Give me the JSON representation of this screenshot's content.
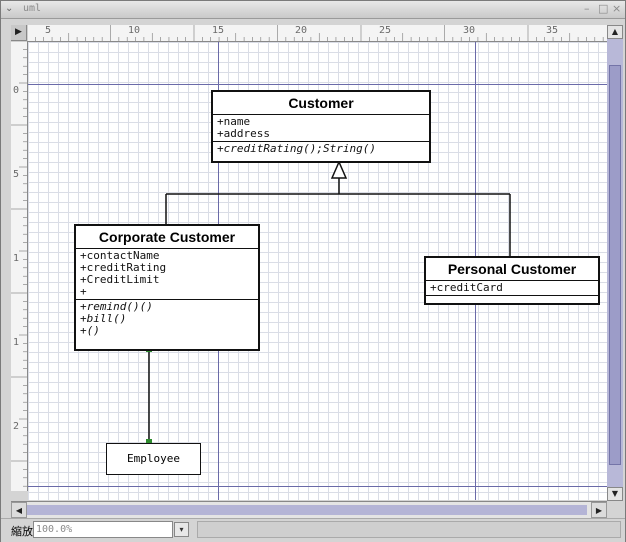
{
  "window": {
    "title": "uml",
    "minimize_glyph": "–",
    "maximize_glyph": "□",
    "close_glyph": "×"
  },
  "ruler": {
    "corner_glyph": "▶",
    "top_labels": [
      "5",
      "10",
      "15",
      "20",
      "25",
      "30",
      "35"
    ],
    "left_labels": [
      "0",
      "5",
      "1",
      "1",
      "2"
    ]
  },
  "diagram": {
    "customer": {
      "name": "Customer",
      "attributes": [
        "+name",
        "+address"
      ],
      "operations": [
        "+creditRating();String()"
      ]
    },
    "corporate": {
      "name": "Corporate Customer",
      "attributes": [
        "+contactName",
        "+creditRating",
        "+CreditLimit",
        "+"
      ],
      "operations": [
        "+remind()()",
        "+bill()",
        "+()"
      ]
    },
    "personal": {
      "name": "Personal Customer",
      "attributes": [
        "+creditCard"
      ],
      "operations": []
    },
    "employee": {
      "name": "Employee"
    }
  },
  "colors": {
    "guide_line": "#6a6aa8",
    "grid": "#dadde6",
    "scrollbar": "#b8b8d8",
    "association_handle": "#2e8b2e"
  },
  "statusbar": {
    "zoom_label": "縮放",
    "zoom_value": "100.0%",
    "dropdown_glyph": "▾"
  },
  "scroll": {
    "up_glyph": "▲",
    "down_glyph": "▼",
    "left_glyph": "◀",
    "right_glyph": "▶"
  }
}
